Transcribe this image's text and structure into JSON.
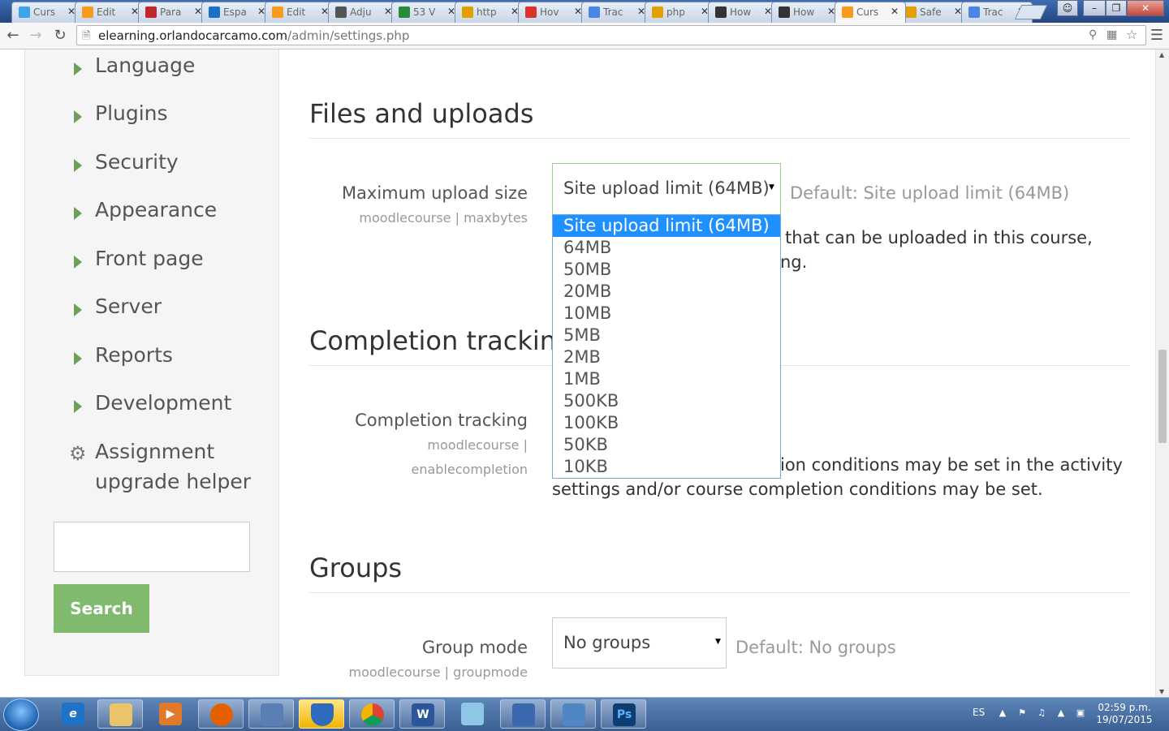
{
  "browser": {
    "tabs": [
      {
        "title": "Curs",
        "favicon": "twitter-icon",
        "color": "#3ca5e8"
      },
      {
        "title": "Edit",
        "favicon": "moodle-icon",
        "color": "#f79b1c"
      },
      {
        "title": "Para",
        "favicon": "parallel-icon",
        "color": "#c0272d"
      },
      {
        "title": "Espa",
        "favicon": "edge-icon",
        "color": "#1e6fc8"
      },
      {
        "title": "Edit",
        "favicon": "moodle-icon",
        "color": "#f79b1c"
      },
      {
        "title": "Adju",
        "favicon": "tool-icon",
        "color": "#555555"
      },
      {
        "title": "53 V",
        "favicon": "dollar-icon",
        "color": "#2a8a3b"
      },
      {
        "title": "http",
        "favicon": "check-icon",
        "color": "#e0a000"
      },
      {
        "title": "Hov",
        "favicon": "c-icon",
        "color": "#d9342b"
      },
      {
        "title": "Trac",
        "favicon": "translate-icon",
        "color": "#4a86e8"
      },
      {
        "title": "php",
        "favicon": "check-icon",
        "color": "#e0a000"
      },
      {
        "title": "How",
        "favicon": "mt-icon",
        "color": "#333333"
      },
      {
        "title": "How",
        "favicon": "mt-icon",
        "color": "#333333"
      },
      {
        "title": "Curs",
        "favicon": "moodle-icon",
        "color": "#f79b1c"
      },
      {
        "title": "Safe",
        "favicon": "check-icon",
        "color": "#e0a000"
      },
      {
        "title": "Trac",
        "favicon": "translate-icon",
        "color": "#4a86e8"
      }
    ],
    "active_tab": 13,
    "url_host": "elearning.orlandocarcamo.com",
    "url_path": "/admin/settings.php"
  },
  "sidebar": {
    "items": [
      {
        "label": "Language"
      },
      {
        "label": "Plugins"
      },
      {
        "label": "Security"
      },
      {
        "label": "Appearance"
      },
      {
        "label": "Front page"
      },
      {
        "label": "Server"
      },
      {
        "label": "Reports"
      },
      {
        "label": "Development"
      }
    ],
    "helper_line1": "Assignment",
    "helper_line2": "upgrade helper",
    "search_value": "",
    "search_button": "Search"
  },
  "sections": {
    "files": {
      "heading": "Files and uploads",
      "setting_label": "Maximum upload size",
      "setting_sub": "moodlecourse | maxbytes",
      "selected": "Site upload limit (64MB)",
      "default": "Default: Site upload limit (64MB)",
      "desc_line1": "that can be uploaded in this course,",
      "desc_line2": "ng.",
      "options": [
        "Site upload limit (64MB)",
        "64MB",
        "50MB",
        "20MB",
        "10MB",
        "5MB",
        "2MB",
        "1MB",
        "500KB",
        "100KB",
        "50KB",
        "10KB"
      ]
    },
    "completion": {
      "heading": "Completion tracking",
      "setting_label": "Completion tracking",
      "setting_sub1": "moodlecourse |",
      "setting_sub2": "enablecompletion",
      "desc_line1": "ion conditions may be set in the activity",
      "desc_line2": "settings and/or course completion conditions may be set."
    },
    "groups": {
      "heading": "Groups",
      "setting_label": "Group mode",
      "setting_sub": "moodlecourse | groupmode",
      "selected": "No groups",
      "default": "Default: No groups"
    }
  },
  "taskbar": {
    "language": "ES",
    "time": "02:59 p.m.",
    "date": "19/07/2015"
  },
  "colors": {
    "accent_green": "#7fba6f",
    "selected_option": "#1e90ff"
  }
}
